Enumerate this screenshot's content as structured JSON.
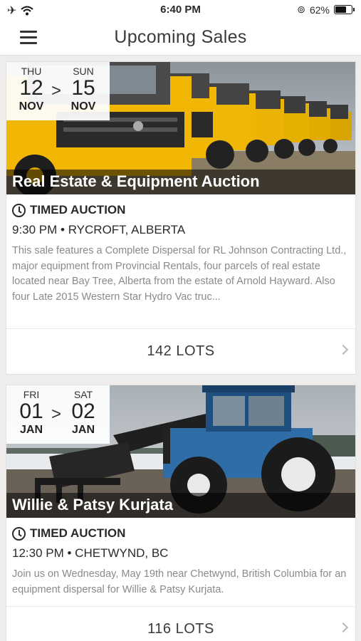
{
  "status_bar": {
    "time": "6:40 PM",
    "battery": "62%"
  },
  "header": {
    "title": "Upcoming Sales"
  },
  "sales": [
    {
      "start_dow": "THU",
      "start_day": "12",
      "start_month": "NOV",
      "end_dow": "SUN",
      "end_day": "15",
      "end_month": "NOV",
      "arrow": ">",
      "title": "Real Estate & Equipment Auction",
      "type": "TIMED AUCTION",
      "time_location": "9:30 PM • RYCROFT, ALBERTA",
      "description": "This sale features a Complete Dispersal for RL Johnson Contracting Ltd., major equipment from Provincial Rentals, four parcels of real estate located near Bay Tree, Alberta from the estate of Arnold Hayward. Also four Late 2015 Western Star Hydro Vac truc...",
      "lots": "142 LOTS"
    },
    {
      "start_dow": "FRI",
      "start_day": "01",
      "start_month": "JAN",
      "end_dow": "SAT",
      "end_day": "02",
      "end_month": "JAN",
      "arrow": ">",
      "title": "Willie & Patsy Kurjata",
      "type": "TIMED AUCTION",
      "time_location": "12:30 PM • CHETWYND, BC",
      "description": "Join us on Wednesday, May 19th near Chetwynd, British Columbia for an equipment dispersal for Willie & Patsy Kurjata.",
      "lots": "116 LOTS"
    }
  ],
  "colors": {
    "accent_yellow": "#f2b705",
    "tractor_blue": "#2f6da8"
  }
}
